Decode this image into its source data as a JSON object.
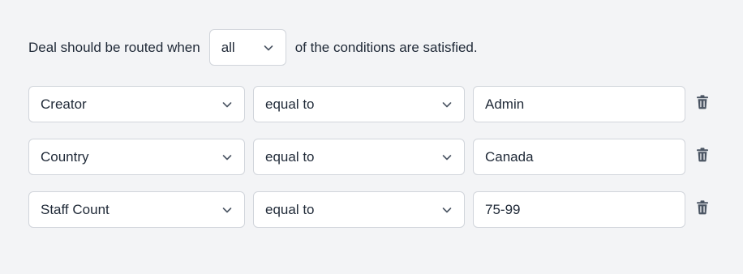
{
  "header": {
    "prefix": "Deal should be routed when",
    "match_value": "all",
    "suffix": "of the conditions are satisfied."
  },
  "conditions": [
    {
      "field": "Creator",
      "operator": "equal to",
      "value": "Admin"
    },
    {
      "field": "Country",
      "operator": "equal to",
      "value": "Canada"
    },
    {
      "field": "Staff Count",
      "operator": "equal to",
      "value": "75-99"
    }
  ],
  "colors": {
    "background": "#f3f4f6",
    "control_border": "#d1d5db",
    "text": "#1f2937",
    "icon": "#4b5563"
  },
  "icons": {
    "dropdown": "chevron-down-icon",
    "delete": "trash-icon"
  }
}
